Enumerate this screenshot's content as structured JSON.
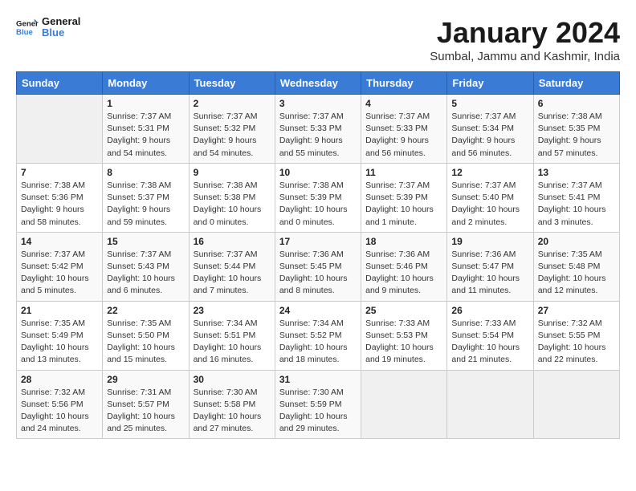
{
  "logo": {
    "general": "General",
    "blue": "Blue"
  },
  "header": {
    "month": "January 2024",
    "location": "Sumbal, Jammu and Kashmir, India"
  },
  "weekdays": [
    "Sunday",
    "Monday",
    "Tuesday",
    "Wednesday",
    "Thursday",
    "Friday",
    "Saturday"
  ],
  "weeks": [
    [
      {
        "day": "",
        "info": ""
      },
      {
        "day": "1",
        "info": "Sunrise: 7:37 AM\nSunset: 5:31 PM\nDaylight: 9 hours\nand 54 minutes."
      },
      {
        "day": "2",
        "info": "Sunrise: 7:37 AM\nSunset: 5:32 PM\nDaylight: 9 hours\nand 54 minutes."
      },
      {
        "day": "3",
        "info": "Sunrise: 7:37 AM\nSunset: 5:33 PM\nDaylight: 9 hours\nand 55 minutes."
      },
      {
        "day": "4",
        "info": "Sunrise: 7:37 AM\nSunset: 5:33 PM\nDaylight: 9 hours\nand 56 minutes."
      },
      {
        "day": "5",
        "info": "Sunrise: 7:37 AM\nSunset: 5:34 PM\nDaylight: 9 hours\nand 56 minutes."
      },
      {
        "day": "6",
        "info": "Sunrise: 7:38 AM\nSunset: 5:35 PM\nDaylight: 9 hours\nand 57 minutes."
      }
    ],
    [
      {
        "day": "7",
        "info": "Sunrise: 7:38 AM\nSunset: 5:36 PM\nDaylight: 9 hours\nand 58 minutes."
      },
      {
        "day": "8",
        "info": "Sunrise: 7:38 AM\nSunset: 5:37 PM\nDaylight: 9 hours\nand 59 minutes."
      },
      {
        "day": "9",
        "info": "Sunrise: 7:38 AM\nSunset: 5:38 PM\nDaylight: 10 hours\nand 0 minutes."
      },
      {
        "day": "10",
        "info": "Sunrise: 7:38 AM\nSunset: 5:39 PM\nDaylight: 10 hours\nand 0 minutes."
      },
      {
        "day": "11",
        "info": "Sunrise: 7:37 AM\nSunset: 5:39 PM\nDaylight: 10 hours\nand 1 minute."
      },
      {
        "day": "12",
        "info": "Sunrise: 7:37 AM\nSunset: 5:40 PM\nDaylight: 10 hours\nand 2 minutes."
      },
      {
        "day": "13",
        "info": "Sunrise: 7:37 AM\nSunset: 5:41 PM\nDaylight: 10 hours\nand 3 minutes."
      }
    ],
    [
      {
        "day": "14",
        "info": "Sunrise: 7:37 AM\nSunset: 5:42 PM\nDaylight: 10 hours\nand 5 minutes."
      },
      {
        "day": "15",
        "info": "Sunrise: 7:37 AM\nSunset: 5:43 PM\nDaylight: 10 hours\nand 6 minutes."
      },
      {
        "day": "16",
        "info": "Sunrise: 7:37 AM\nSunset: 5:44 PM\nDaylight: 10 hours\nand 7 minutes."
      },
      {
        "day": "17",
        "info": "Sunrise: 7:36 AM\nSunset: 5:45 PM\nDaylight: 10 hours\nand 8 minutes."
      },
      {
        "day": "18",
        "info": "Sunrise: 7:36 AM\nSunset: 5:46 PM\nDaylight: 10 hours\nand 9 minutes."
      },
      {
        "day": "19",
        "info": "Sunrise: 7:36 AM\nSunset: 5:47 PM\nDaylight: 10 hours\nand 11 minutes."
      },
      {
        "day": "20",
        "info": "Sunrise: 7:35 AM\nSunset: 5:48 PM\nDaylight: 10 hours\nand 12 minutes."
      }
    ],
    [
      {
        "day": "21",
        "info": "Sunrise: 7:35 AM\nSunset: 5:49 PM\nDaylight: 10 hours\nand 13 minutes."
      },
      {
        "day": "22",
        "info": "Sunrise: 7:35 AM\nSunset: 5:50 PM\nDaylight: 10 hours\nand 15 minutes."
      },
      {
        "day": "23",
        "info": "Sunrise: 7:34 AM\nSunset: 5:51 PM\nDaylight: 10 hours\nand 16 minutes."
      },
      {
        "day": "24",
        "info": "Sunrise: 7:34 AM\nSunset: 5:52 PM\nDaylight: 10 hours\nand 18 minutes."
      },
      {
        "day": "25",
        "info": "Sunrise: 7:33 AM\nSunset: 5:53 PM\nDaylight: 10 hours\nand 19 minutes."
      },
      {
        "day": "26",
        "info": "Sunrise: 7:33 AM\nSunset: 5:54 PM\nDaylight: 10 hours\nand 21 minutes."
      },
      {
        "day": "27",
        "info": "Sunrise: 7:32 AM\nSunset: 5:55 PM\nDaylight: 10 hours\nand 22 minutes."
      }
    ],
    [
      {
        "day": "28",
        "info": "Sunrise: 7:32 AM\nSunset: 5:56 PM\nDaylight: 10 hours\nand 24 minutes."
      },
      {
        "day": "29",
        "info": "Sunrise: 7:31 AM\nSunset: 5:57 PM\nDaylight: 10 hours\nand 25 minutes."
      },
      {
        "day": "30",
        "info": "Sunrise: 7:30 AM\nSunset: 5:58 PM\nDaylight: 10 hours\nand 27 minutes."
      },
      {
        "day": "31",
        "info": "Sunrise: 7:30 AM\nSunset: 5:59 PM\nDaylight: 10 hours\nand 29 minutes."
      },
      {
        "day": "",
        "info": ""
      },
      {
        "day": "",
        "info": ""
      },
      {
        "day": "",
        "info": ""
      }
    ]
  ]
}
